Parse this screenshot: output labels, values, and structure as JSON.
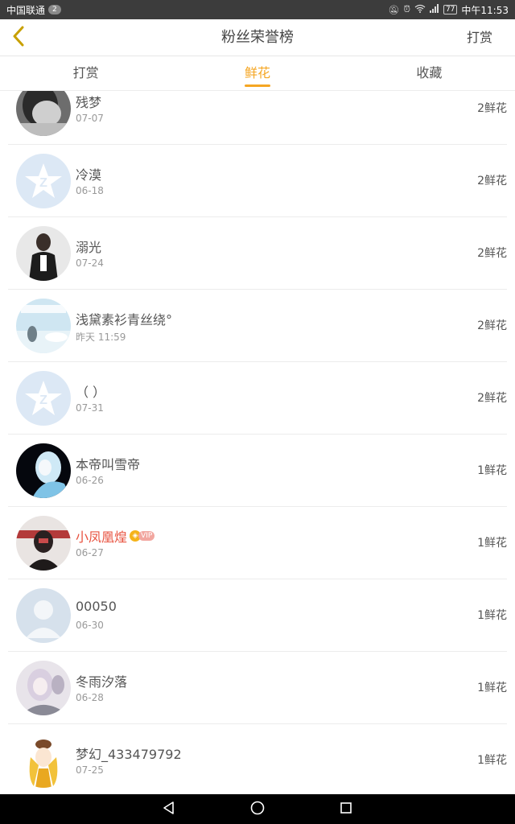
{
  "status_bar": {
    "carrier": "中国联通",
    "notification_count": "2",
    "battery": "77",
    "time": "中午11:53",
    "icons": [
      "mute-icon",
      "alarm-icon",
      "wifi-icon",
      "signal-icon"
    ]
  },
  "header": {
    "back_icon": "chevron-left-icon",
    "title": "粉丝荣誉榜",
    "action_label": "打赏",
    "accent_color": "#f5a623"
  },
  "tabs": [
    {
      "label": "打赏",
      "active": false
    },
    {
      "label": "鲜花",
      "active": true
    },
    {
      "label": "收藏",
      "active": false
    }
  ],
  "fans": [
    {
      "name": "残梦",
      "date": "07-07",
      "count": "2鲜花",
      "vip": false
    },
    {
      "name": "冷漠",
      "date": "06-18",
      "count": "2鲜花",
      "vip": false
    },
    {
      "name": "溺光",
      "date": "07-24",
      "count": "2鲜花",
      "vip": false
    },
    {
      "name": "浅黛素衫青丝绕°",
      "date": "昨天 11:59",
      "count": "2鲜花",
      "vip": false
    },
    {
      "name": "（ ）",
      "date": "07-31",
      "count": "2鲜花",
      "vip": false
    },
    {
      "name": "本帝叫雪帝",
      "date": "06-26",
      "count": "1鲜花",
      "vip": false
    },
    {
      "name": "小凤凰煌",
      "date": "06-27",
      "count": "1鲜花",
      "vip": true,
      "vip_label": "VIP"
    },
    {
      "name": "00050",
      "date": "06-30",
      "count": "1鲜花",
      "vip": false
    },
    {
      "name": "冬雨汐落",
      "date": "06-28",
      "count": "1鲜花",
      "vip": false
    },
    {
      "name": "梦幻_433479792",
      "date": "07-25",
      "count": "1鲜花",
      "vip": false
    }
  ],
  "nav_bar": {
    "icons": [
      "back-triangle-icon",
      "home-circle-icon",
      "recents-square-icon"
    ]
  }
}
